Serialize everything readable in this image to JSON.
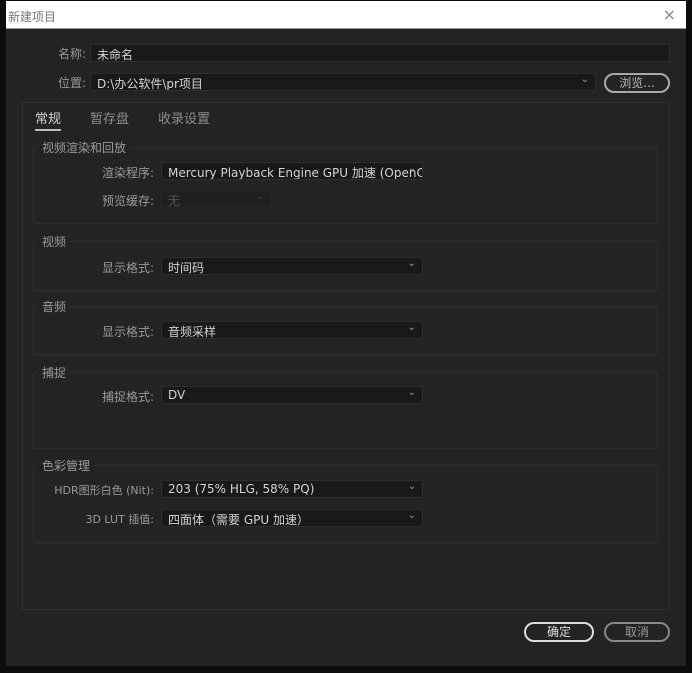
{
  "window": {
    "title": "新建项目",
    "close_icon": "×"
  },
  "name": {
    "label": "名称:",
    "value": "未命名"
  },
  "location": {
    "label": "位置:",
    "value": "D:\\办公软件\\pr项目",
    "browse": "浏览..."
  },
  "tabs": [
    {
      "label": "常规"
    },
    {
      "label": "暂存盘"
    },
    {
      "label": "收录设置"
    }
  ],
  "groups": {
    "render": {
      "title": "视频渲染和回放",
      "renderer_label": "渲染程序:",
      "renderer_value": "Mercury Playback Engine GPU 加速 (OpenCL)",
      "cache_label": "预览缓存:",
      "cache_value": "无"
    },
    "video": {
      "title": "视频",
      "format_label": "显示格式:",
      "format_value": "时间码"
    },
    "audio": {
      "title": "音频",
      "format_label": "显示格式:",
      "format_value": "音频采样"
    },
    "capture": {
      "title": "捕捉",
      "format_label": "捕捉格式:",
      "format_value": "DV"
    },
    "color": {
      "title": "色彩管理",
      "hdr_label": "HDR图形白色 (Nit):",
      "hdr_value": "203 (75% HLG, 58% PQ)",
      "lut_label": "3D LUT 插值:",
      "lut_value": "四面体（需要 GPU 加速）"
    }
  },
  "buttons": {
    "ok": "确定",
    "cancel": "取消"
  },
  "chevron": "⌄"
}
